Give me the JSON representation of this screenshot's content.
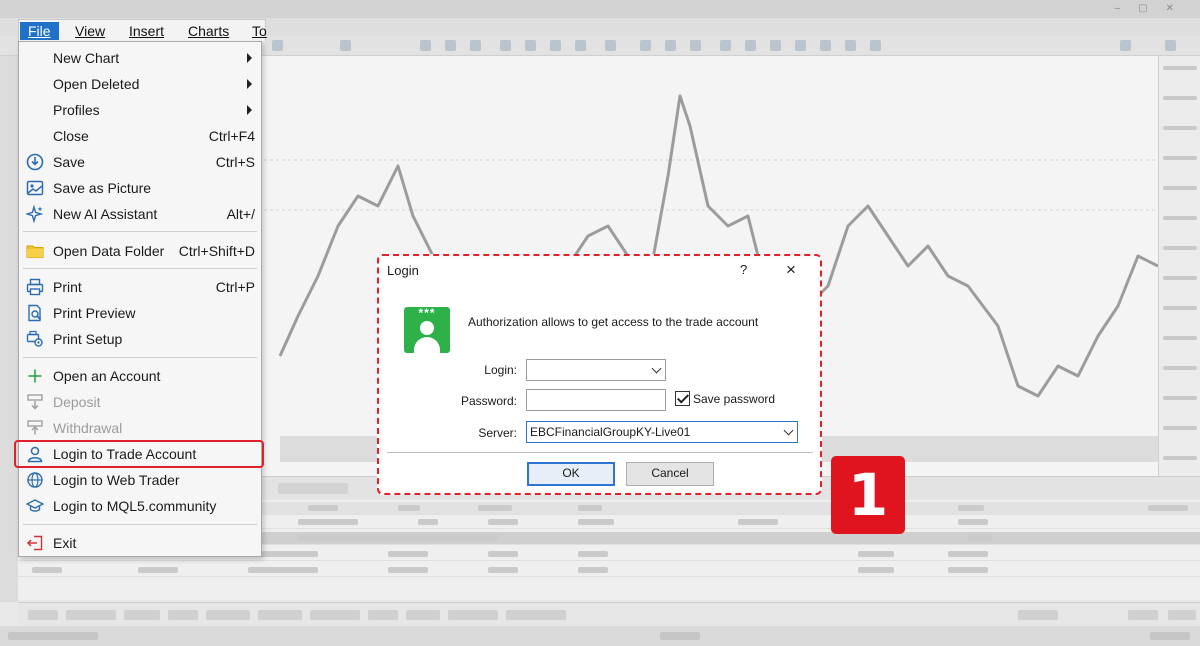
{
  "menubar": {
    "items": [
      "File",
      "View",
      "Insert",
      "Charts",
      "To"
    ]
  },
  "file_menu": {
    "items": [
      {
        "label": "New Chart",
        "submenu": true,
        "icon": "none"
      },
      {
        "label": "Open Deleted",
        "submenu": true,
        "icon": "none"
      },
      {
        "label": "Profiles",
        "submenu": true,
        "icon": "none"
      },
      {
        "label": "Close",
        "shortcut": "Ctrl+F4",
        "icon": "none"
      },
      {
        "label": "Save",
        "shortcut": "Ctrl+S",
        "icon": "save-icon"
      },
      {
        "label": "Save as Picture",
        "icon": "picture-icon"
      },
      {
        "label": "New AI Assistant",
        "shortcut": "Alt+/",
        "icon": "ai-sparkle-icon"
      },
      {
        "label": "Open Data Folder",
        "shortcut": "Ctrl+Shift+D",
        "icon": "folder-icon"
      },
      {
        "label": "Print",
        "shortcut": "Ctrl+P",
        "icon": "printer-icon"
      },
      {
        "label": "Print Preview",
        "icon": "print-preview-icon"
      },
      {
        "label": "Print Setup",
        "icon": "print-setup-icon"
      },
      {
        "label": "Open an Account",
        "icon": "plus-icon"
      },
      {
        "label": "Deposit",
        "disabled": true,
        "icon": "deposit-icon"
      },
      {
        "label": "Withdrawal",
        "disabled": true,
        "icon": "withdrawal-icon"
      },
      {
        "label": "Login to Trade Account",
        "highlighted": true,
        "icon": "user-icon"
      },
      {
        "label": "Login to Web Trader",
        "icon": "globe-icon"
      },
      {
        "label": "Login to MQL5.community",
        "icon": "graduation-cap-icon"
      },
      {
        "label": "Exit",
        "icon": "exit-icon"
      }
    ]
  },
  "login_dialog": {
    "title": "Login",
    "help": "?",
    "close": "×",
    "message": "Authorization allows to get access to the trade account",
    "avatar_text": "***",
    "login_label": "Login:",
    "login_value": "",
    "password_label": "Password:",
    "password_value": "",
    "save_password_label": "Save password",
    "save_password_checked": true,
    "server_label": "Server:",
    "server_value": "EBCFinancialGroupKY-Live01",
    "ok_label": "OK",
    "cancel_label": "Cancel"
  },
  "step_badge": "1",
  "colors": {
    "menu_active": "#1e70c8",
    "highlight": "#e0202a",
    "badge": "#e0141e",
    "avatar_green": "#2fb14a",
    "focus_blue": "#2f74d0"
  }
}
